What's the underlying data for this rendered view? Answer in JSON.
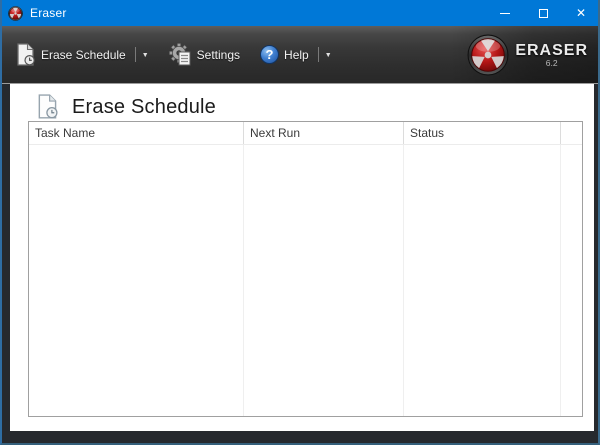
{
  "window": {
    "title": "Eraser",
    "close_glyph": "✕"
  },
  "toolbar": {
    "dropdown_glyph": "▼",
    "help_glyph": "?",
    "items": [
      {
        "label": "Erase Schedule",
        "icon": "document-clock-icon",
        "has_dropdown": true
      },
      {
        "label": "Settings",
        "icon": "gear-icon",
        "has_dropdown": false
      },
      {
        "label": "Help",
        "icon": "question-mark-icon",
        "has_dropdown": true
      }
    ],
    "logo": {
      "brand": "ERASER",
      "version": "6.2"
    }
  },
  "main": {
    "heading": "Erase Schedule"
  },
  "schedule_table": {
    "columns": [
      "Task Name",
      "Next Run",
      "Status"
    ],
    "rows": []
  },
  "colors": {
    "titlebar_blue": "#0078d7",
    "toolbar_dark": "#2e2e2e",
    "emblem_red": "#a81414",
    "table_border": "#a0a0a0"
  }
}
